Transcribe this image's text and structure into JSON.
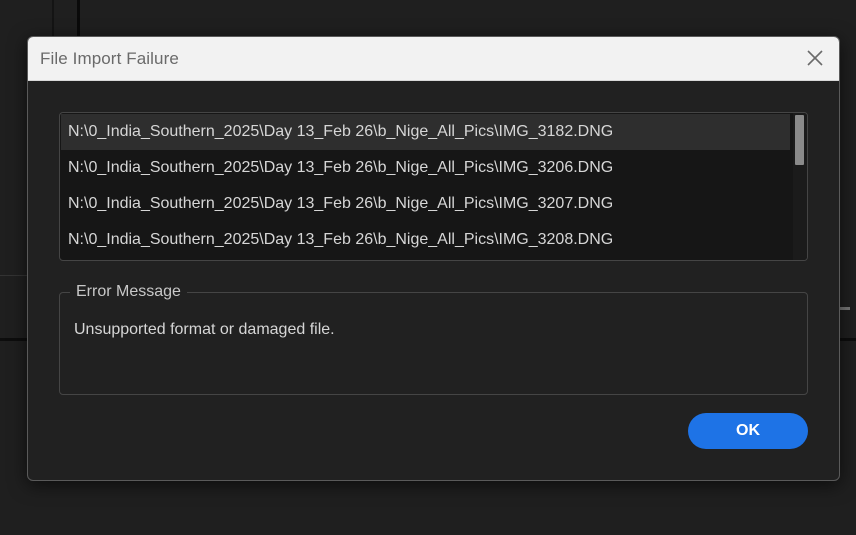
{
  "dialog": {
    "title": "File Import Failure",
    "close_icon": "close-icon"
  },
  "file_list": {
    "items": [
      "N:\\0_India_Southern_2025\\Day 13_Feb 26\\b_Nige_All_Pics\\IMG_3182.DNG",
      "N:\\0_India_Southern_2025\\Day 13_Feb 26\\b_Nige_All_Pics\\IMG_3206.DNG",
      "N:\\0_India_Southern_2025\\Day 13_Feb 26\\b_Nige_All_Pics\\IMG_3207.DNG",
      "N:\\0_India_Southern_2025\\Day 13_Feb 26\\b_Nige_All_Pics\\IMG_3208.DNG"
    ],
    "selected_index": 0
  },
  "error": {
    "legend": "Error Message",
    "message": "Unsupported format or damaged file."
  },
  "buttons": {
    "ok_label": "OK"
  },
  "colors": {
    "accent": "#1e73e6",
    "titlebar": "#f2f2f2",
    "dialog_bg": "#212121"
  }
}
